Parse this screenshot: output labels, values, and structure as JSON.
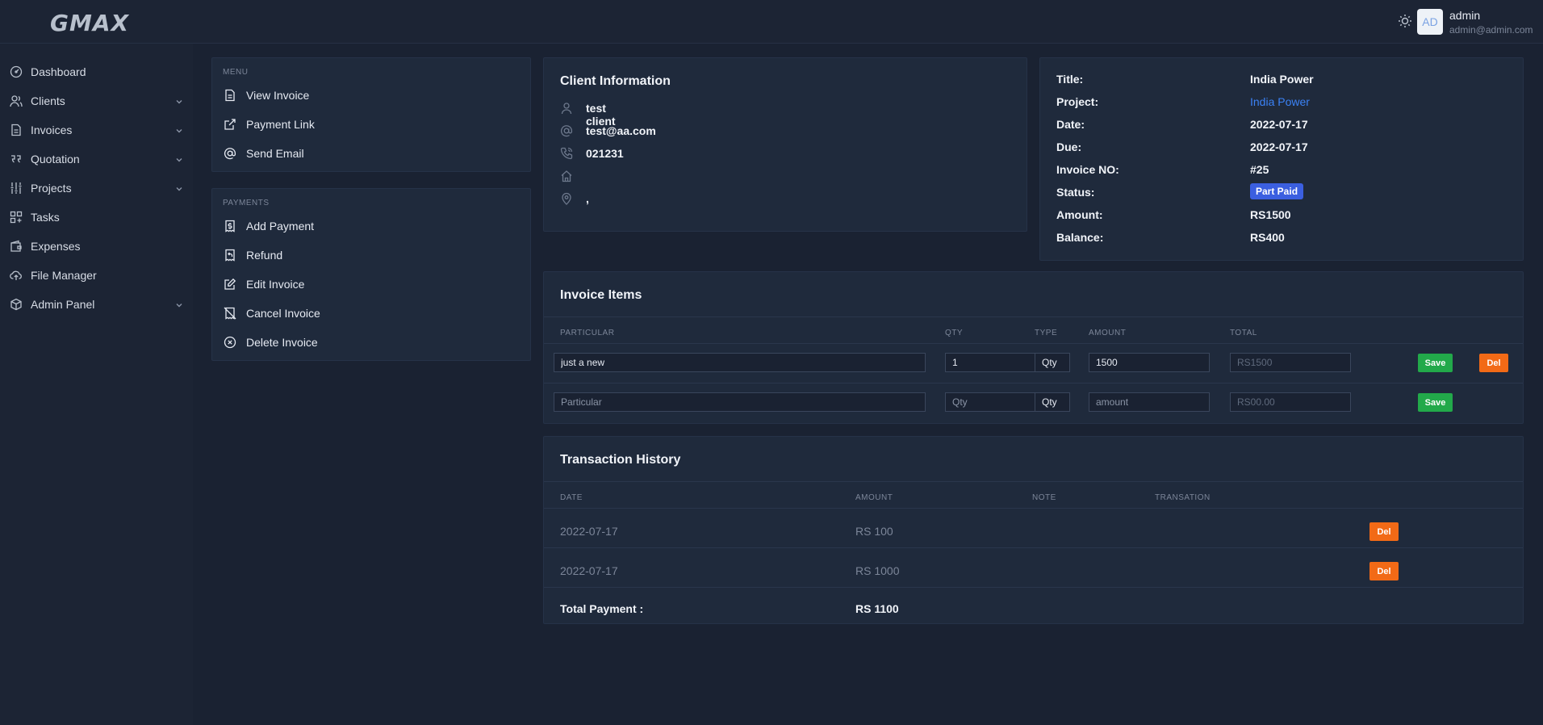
{
  "header": {
    "logo": "GMAX",
    "avatar_initials": "AD",
    "user_name": "admin",
    "user_email": "admin@admin.com"
  },
  "sidebar": {
    "items": [
      {
        "label": "Dashboard",
        "icon": "dashboard-icon",
        "expandable": false
      },
      {
        "label": "Clients",
        "icon": "users-icon",
        "expandable": true
      },
      {
        "label": "Invoices",
        "icon": "file-icon",
        "expandable": true
      },
      {
        "label": "Quotation",
        "icon": "quote-icon",
        "expandable": true
      },
      {
        "label": "Projects",
        "icon": "sliders-icon",
        "expandable": true
      },
      {
        "label": "Tasks",
        "icon": "grid-icon",
        "expandable": false
      },
      {
        "label": "Expenses",
        "icon": "wallet-icon",
        "expandable": false
      },
      {
        "label": "File Manager",
        "icon": "cloud-upload-icon",
        "expandable": false
      },
      {
        "label": "Admin Panel",
        "icon": "box-icon",
        "expandable": true
      }
    ]
  },
  "action_menu": {
    "menu_title": "MENU",
    "menu_items": [
      {
        "label": "View Invoice",
        "icon": "file-text-icon"
      },
      {
        "label": "Payment Link",
        "icon": "external-link-icon"
      },
      {
        "label": "Send Email",
        "icon": "at-sign-icon"
      }
    ],
    "payments_title": "PAYMENTS",
    "payment_items": [
      {
        "label": "Add Payment",
        "icon": "receipt-dollar-icon"
      },
      {
        "label": "Refund",
        "icon": "receipt-refund-icon"
      },
      {
        "label": "Edit Invoice",
        "icon": "edit-icon"
      },
      {
        "label": "Cancel Invoice",
        "icon": "receipt-cancel-icon"
      },
      {
        "label": "Delete Invoice",
        "icon": "x-circle-icon"
      }
    ]
  },
  "client_info": {
    "title": "Client Information",
    "name": "test client",
    "email": "test@aa.com",
    "phone": "021231",
    "address": "",
    "location": ","
  },
  "invoice_info": {
    "title_label": "Title:",
    "title_value": "India Power",
    "project_label": "Project:",
    "project_value": "India Power",
    "date_label": "Date:",
    "date_value": "2022-07-17",
    "due_label": "Due:",
    "due_value": "2022-07-17",
    "invoice_no_label": "Invoice NO:",
    "invoice_no_value": "#25",
    "status_label": "Status:",
    "status_value": "Part Paid",
    "amount_label": "Amount:",
    "amount_value": "RS1500",
    "balance_label": "Balance:",
    "balance_value": "RS400"
  },
  "invoice_items": {
    "title": "Invoice Items",
    "headers": {
      "particular": "PARTICULAR",
      "qty": "QTY",
      "type": "TYPE",
      "amount": "AMOUNT",
      "total": "TOTAL"
    },
    "rows": [
      {
        "particular": "just a new",
        "qty": "1",
        "type": "Qty",
        "amount": "1500",
        "total_placeholder": "RS1500",
        "save": "Save",
        "del": "Del"
      }
    ],
    "new_row": {
      "particular_placeholder": "Particular",
      "qty_placeholder": "Qty",
      "type": "Qty",
      "amount_placeholder": "amount",
      "total_placeholder": "RS00.00",
      "save": "Save"
    }
  },
  "transactions": {
    "title": "Transaction History",
    "headers": {
      "date": "DATE",
      "amount": "AMOUNT",
      "note": "NOTE",
      "transaction": "TRANSATION"
    },
    "rows": [
      {
        "date": "2022-07-17",
        "amount": "RS 100",
        "note": "",
        "transaction": "",
        "del": "Del"
      },
      {
        "date": "2022-07-17",
        "amount": "RS 1000",
        "note": "",
        "transaction": "",
        "del": "Del"
      }
    ],
    "total_label": "Total Payment :",
    "total_value": "RS 1100"
  },
  "colors": {
    "background": "#1a2232",
    "card": "#1f2a3c",
    "accent_blue": "#3b5fe0",
    "link_blue": "#3b82f6",
    "save_green": "#22a94a",
    "del_orange": "#f26a16"
  }
}
